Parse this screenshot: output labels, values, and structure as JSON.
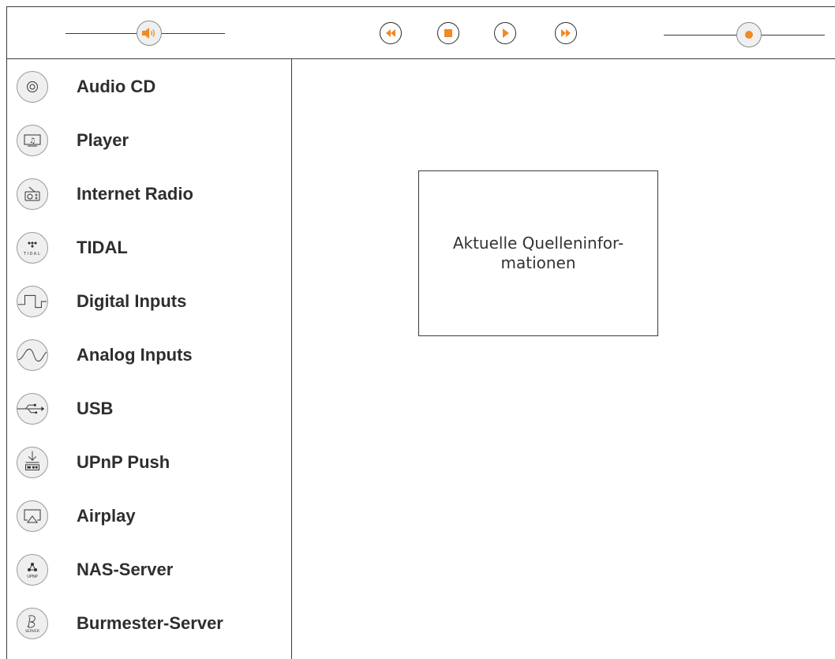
{
  "colors": {
    "accent": "#f08a24",
    "line": "#3a3a3a",
    "knob_fill": "#efefef"
  },
  "toolbar": {
    "volume_knob_icon": "speaker-icon",
    "controls": [
      {
        "name": "rewind-button",
        "icon": "rewind-icon"
      },
      {
        "name": "stop-button",
        "icon": "stop-icon"
      },
      {
        "name": "play-button",
        "icon": "play-icon"
      },
      {
        "name": "fast-forward-button",
        "icon": "fast-forward-icon"
      }
    ],
    "position_knob_icon": "dot-icon"
  },
  "sources": [
    {
      "label": "Audio CD",
      "icon": "cd-icon"
    },
    {
      "label": "Player",
      "icon": "player-icon"
    },
    {
      "label": "Internet Radio",
      "icon": "radio-icon"
    },
    {
      "label": "TIDAL",
      "icon": "tidal-icon",
      "icon_text": "TIDAL"
    },
    {
      "label": "Digital Inputs",
      "icon": "square-wave-icon"
    },
    {
      "label": "Analog Inputs",
      "icon": "sine-wave-icon"
    },
    {
      "label": "USB",
      "icon": "usb-icon"
    },
    {
      "label": "UPnP Push",
      "icon": "upnp-push-icon"
    },
    {
      "label": "Airplay",
      "icon": "airplay-icon"
    },
    {
      "label": "NAS-Server",
      "icon": "nas-server-icon",
      "icon_text": "UPNP"
    },
    {
      "label": "Burmester-Server",
      "icon": "burmester-server-icon",
      "icon_text": "SERVER"
    }
  ],
  "info": {
    "text": "Aktuelle Quelleninfor-\nmationen"
  }
}
